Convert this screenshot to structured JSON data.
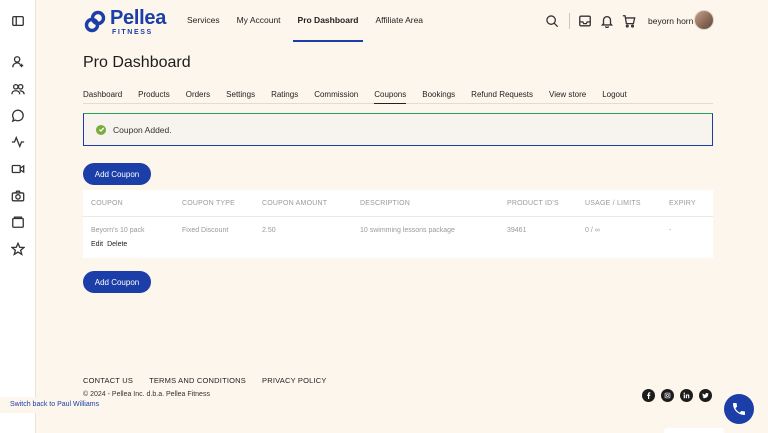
{
  "brand": {
    "name": "Pellea",
    "sub": "FITNESS",
    "color": "#1b3ea8"
  },
  "topnav": [
    {
      "label": "Services"
    },
    {
      "label": "My Account"
    },
    {
      "label": "Pro Dashboard",
      "active": true
    },
    {
      "label": "Affiliate Area"
    }
  ],
  "top_icons": [
    "search-icon",
    "inbox-icon",
    "bell-icon",
    "cart-icon"
  ],
  "user": {
    "name": "beyorn horn"
  },
  "left_rail_icons": [
    "panel-toggle-icon",
    "user-icon",
    "users-icon",
    "chat-icon",
    "activity-icon",
    "video-icon",
    "camera-icon",
    "folder-icon",
    "star-icon"
  ],
  "page": {
    "title": "Pro Dashboard"
  },
  "subtabs": [
    {
      "label": "Dashboard"
    },
    {
      "label": "Products"
    },
    {
      "label": "Orders"
    },
    {
      "label": "Settings"
    },
    {
      "label": "Ratings"
    },
    {
      "label": "Commission"
    },
    {
      "label": "Coupons",
      "active": true
    },
    {
      "label": "Bookings"
    },
    {
      "label": "Refund Requests"
    },
    {
      "label": "View store"
    },
    {
      "label": "Logout"
    }
  ],
  "notice": {
    "text": "Coupon Added.",
    "status_color": "#7aac3a"
  },
  "buttons": {
    "add_coupon_top": "Add Coupon",
    "add_coupon_bottom": "Add Coupon"
  },
  "table": {
    "headers": [
      "COUPON",
      "COUPON TYPE",
      "COUPON AMOUNT",
      "DESCRIPTION",
      "PRODUCT ID'S",
      "USAGE / LIMITS",
      "EXPIRY"
    ],
    "rows": [
      {
        "coupon": "Beyorn's 10 pack",
        "type": "Fixed Discount",
        "amount": "2.50",
        "description": "10 swimming lessons package",
        "product_ids": "39461",
        "usage": "0 / ∞",
        "expiry": "-",
        "actions": {
          "edit": "Edit",
          "delete": "Delete"
        }
      }
    ]
  },
  "footer": {
    "links": [
      "CONTACT US",
      "TERMS AND CONDITIONS",
      "PRIVACY POLICY"
    ],
    "copyright": "© 2024 - Pellea Inc. d.b.a. Pellea Fitness",
    "socials": [
      "facebook-icon",
      "instagram-icon",
      "linkedin-icon",
      "twitter-icon"
    ]
  },
  "switch_back": "Switch back to Paul Williams"
}
